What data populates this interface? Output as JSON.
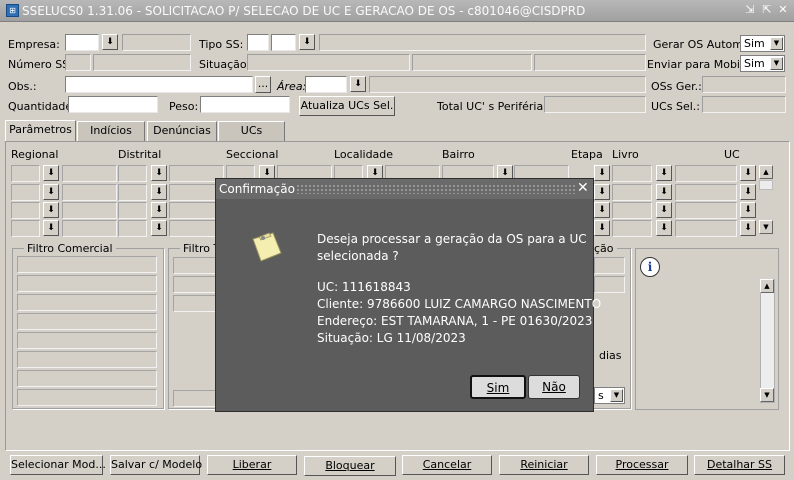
{
  "window": {
    "title": "SSELUCS0 1.31.06 - SOLICITACAO P/ SELECAO DE UC E GERACAO DE OS  - c801046@CISDPRD",
    "icon": "app-icon"
  },
  "form": {
    "empresa_label": "Empresa:",
    "tipo_ss_label": "Tipo SS:",
    "gerar_os_label": "Gerar OS Autom.:",
    "gerar_os_value": "Sim",
    "numero_ss_label": "Número SS:",
    "situacao_label": "Situação:",
    "enviar_mobile_label": "Enviar para Mobile:",
    "enviar_mobile_value": "Sim",
    "obs_label": "Obs.:",
    "obs_btn": "...",
    "area_label": "Área:",
    "oss_ger_label": "OSs Ger.:",
    "quantidade_label": "Quantidade:",
    "peso_label": "Peso:",
    "atualiza_btn": "Atualiza UCs Sel.",
    "total_uc_label": "Total UC' s Periféria:",
    "ucs_sel_label": "UCs Sel.:"
  },
  "tabs": [
    "Parâmetros",
    "Indícios",
    "Denúncias",
    "UCs"
  ],
  "grid_headers": {
    "regional": "Regional",
    "distrital": "Distrital",
    "seccional": "Seccional",
    "localidade": "Localidade",
    "bairro": "Bairro",
    "etapa": "Etapa",
    "livro": "Livro",
    "uc": "UC"
  },
  "groups": {
    "filtro_comercial": "Filtro Comercial",
    "filtro_t": "Filtro T",
    "right_title": "ção",
    "dias": "dias",
    "s_select": "s"
  },
  "buttons": [
    "Selecionar Mod...",
    "Salvar c/ Modelo",
    "Liberar",
    "Bloquear",
    "Cancelar",
    "Reiniciar",
    "Processar",
    "Detalhar SS"
  ],
  "dialog": {
    "title": "Confirmação",
    "line1": "Deseja processar a geração da OS para a UC",
    "line2": "selecionada ?",
    "uc": "UC: 111618843",
    "cliente": "Cliente: 9786600 LUIZ CAMARGO NASCIMENTO",
    "endereco": "Endereço: EST TAMARANA, 1 - PE 01630/2023",
    "situacao": "Situação: LG 11/08/2023",
    "yes": "Sim",
    "no": "Não"
  }
}
